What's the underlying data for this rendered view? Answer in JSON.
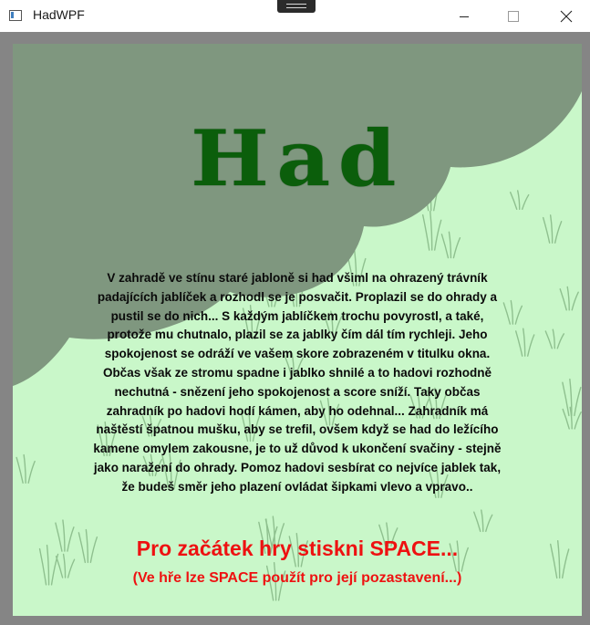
{
  "window": {
    "title": "HadWPF",
    "icon": "app-window-icon",
    "controls": [
      "minimize-icon",
      "maximize-icon",
      "close-icon"
    ]
  },
  "game": {
    "title": "Had",
    "story_lines": [
      "V zahradě ve stínu staré jabloně si had všiml na ohrazený trávník",
      "padajících jablíček a rozhodl se je posvačit. Proplazil se do ohrady a",
      "pustil se do nich... S každým jablíčkem trochu povyrostl, a také,",
      "protože mu chutnalo, plazil se za jablky čím dál tím rychleji. Jeho",
      "spokojenost se odráží ve vašem skore zobrazeném v titulku okna.",
      "Občas však ze stromu spadne i jablko shnilé a to hadovi rozhodně",
      "nechutná - snězení jeho spokojenost a score sníží. Taky občas",
      "zahradník po hadovi hodí kámen, aby ho odehnal... Zahradník má",
      "naštěstí špatnou mušku, aby se trefil, ovšem když se had do ležícího",
      "kamene omylem zakousne, je to už důvod k ukončení svačiny - stejně",
      "jako naražení do ohrady. Pomoz hadovi sesbírat co nejvíce jablek tak,",
      "že budeš směr jeho plazení ovládat šipkami vlevo a vpravo.."
    ],
    "start_prompt": "Pro začátek hry stiskni SPACE...",
    "pause_hint": "(Ve hře lze SPACE použít pro její pozastavení...)"
  },
  "colors": {
    "lawn": "#c9f7c9",
    "tree_shadow": "#7f977f",
    "title_green": "#0b5e0b",
    "prompt_red": "#ee1111",
    "frame_gray": "#858585"
  }
}
